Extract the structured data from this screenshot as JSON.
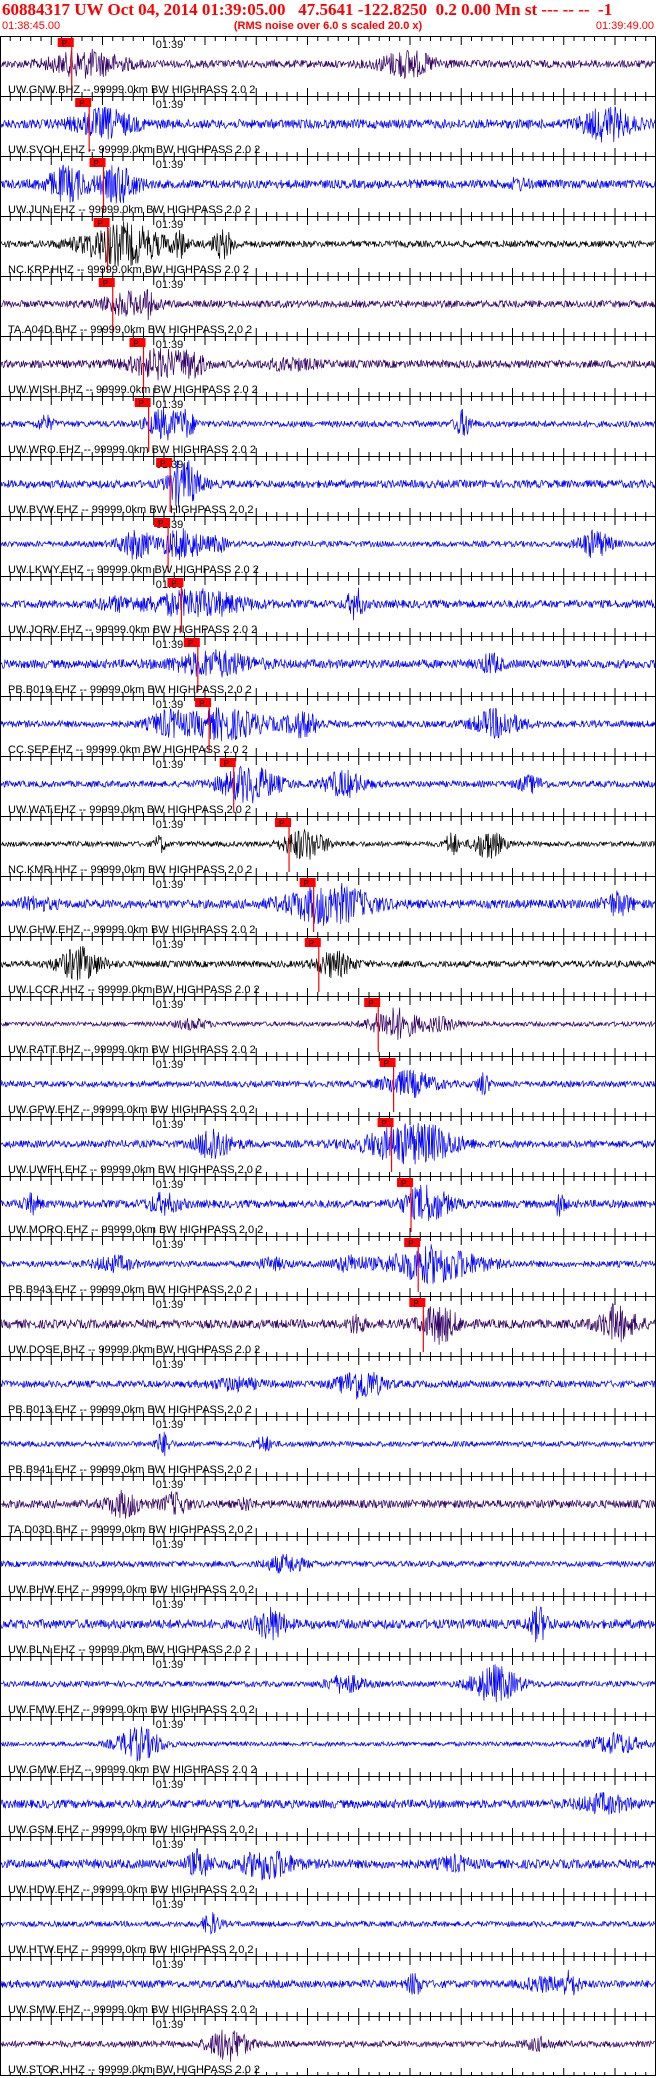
{
  "header": {
    "title": "60884317 UW Oct 04, 2014 01:39:05.00   47.5641 -122.8250  0.2 0.00 Mn st --- -- --  -1",
    "start_time": "01:38:45.00",
    "noise_note": "(RMS noise over 6.0 s scaled 20.0 x)",
    "end_time": "01:39:49.00"
  },
  "chart_data": {
    "type": "seismogram",
    "time_window": [
      "01:38:45.00",
      "01:39:49.00"
    ],
    "minute_tick_label": "01:39",
    "pick_label": "P",
    "colors": {
      "pick": "#ff0000",
      "blue": "#0000ff",
      "dark": "#330066",
      "black": "#000000",
      "axis": "#000000",
      "text": "#000000"
    },
    "traces": [
      {
        "label": "UW.GNW.BHZ -- 99999.0km BW  HIGHPASS  2.0  2",
        "color": "dark",
        "pick_s": 7.0
      },
      {
        "label": "UW.SVOH.EHZ -- 99999.0km BW  HIGHPASS  2.0  2",
        "color": "blue",
        "pick_s": 8.7
      },
      {
        "label": "UW.JUN.EHZ -- 99999.0km BW  HIGHPASS  2.0  2",
        "color": "blue",
        "pick_s": 10.1
      },
      {
        "label": "NC.KRP.HHZ -- 99999.0km BW  HIGHPASS  2.0  2",
        "color": "black",
        "pick_s": 10.5
      },
      {
        "label": "TA.A04D.BHZ -- 99999.0km BW  HIGHPASS  2.0  2",
        "color": "dark",
        "pick_s": 11.0
      },
      {
        "label": "UW.WISH.BHZ -- 99999.0km BW  HIGHPASS  2.0  2",
        "color": "dark",
        "pick_s": 14.0
      },
      {
        "label": "UW.WRO.EHZ -- 99999.0km BW  HIGHPASS  2.0  2",
        "color": "blue",
        "pick_s": 14.5
      },
      {
        "label": "UW.BVW.EHZ -- 99999.0km BW  HIGHPASS  2.0  2",
        "color": "blue",
        "pick_s": 16.6
      },
      {
        "label": "UW.LKWY.EHZ -- 99999.0km BW  HIGHPASS  2.0  2",
        "color": "blue",
        "pick_s": 16.4
      },
      {
        "label": "UW.JORV.EHZ -- 99999.0km BW  HIGHPASS  2.0  2",
        "color": "blue",
        "pick_s": 17.7
      },
      {
        "label": "PB.B019.EHZ -- 99999.0km BW  HIGHPASS  2.0  2",
        "color": "blue",
        "pick_s": 19.3
      },
      {
        "label": "CC.SEP.EHZ -- 99999.0km BW  HIGHPASS  2.0  2",
        "color": "blue",
        "pick_s": 20.4
      },
      {
        "label": "UW.WAT.EHZ -- 99999.0km BW  HIGHPASS  2.0  2",
        "color": "blue",
        "pick_s": 22.8
      },
      {
        "label": "NC.KMR.HHZ -- 99999.0km BW  HIGHPASS  2.0  2",
        "color": "black",
        "pick_s": 28.2
      },
      {
        "label": "UW.GHW.EHZ -- 99999.0km BW  HIGHPASS  2.0  2",
        "color": "blue",
        "pick_s": 30.6
      },
      {
        "label": "UW.LCCR.HHZ -- 99999.0km BW  HIGHPASS  2.0  2",
        "color": "black",
        "pick_s": 31.1
      },
      {
        "label": "UW.RATT.BHZ -- 99999.0km BW  HIGHPASS  2.0  2",
        "color": "dark",
        "pick_s": 36.9
      },
      {
        "label": "UW.GPW.EHZ -- 99999.0km BW  HIGHPASS  2.0  2",
        "color": "blue",
        "pick_s": 38.4
      },
      {
        "label": "UW.UWFH.EHZ -- 99999.0km BW  HIGHPASS  2.0  2",
        "color": "blue",
        "pick_s": 38.2
      },
      {
        "label": "UW.MORO.EHZ -- 99999.0km BW  HIGHPASS  2.0  2",
        "color": "blue",
        "pick_s": 40.1
      },
      {
        "label": "PB.B943.EHZ -- 99999.0km BW  HIGHPASS  2.0  2",
        "color": "blue",
        "pick_s": 40.8
      },
      {
        "label": "UW.DOSE.BHZ -- 99999.0km BW  HIGHPASS  2.0  2",
        "color": "dark",
        "pick_s": 41.3
      },
      {
        "label": "PB.B013.EHZ -- 99999.0km BW  HIGHPASS  2.0  2",
        "color": "blue",
        "pick_s": null
      },
      {
        "label": "PB.B941.EHZ -- 99999.0km BW  HIGHPASS  2.0  2",
        "color": "blue",
        "pick_s": null
      },
      {
        "label": "TA.D03D.BHZ -- 99999.0km BW  HIGHPASS  2.0  2",
        "color": "dark",
        "pick_s": null
      },
      {
        "label": "UW.BHW.EHZ -- 99999.0km BW  HIGHPASS  2.0  2",
        "color": "blue",
        "pick_s": null
      },
      {
        "label": "UW.BLN.EHZ -- 99999.0km BW  HIGHPASS  2.0  2",
        "color": "blue",
        "pick_s": null
      },
      {
        "label": "UW.FMW.EHZ -- 99999.0km BW  HIGHPASS  2.0  2",
        "color": "blue",
        "pick_s": null
      },
      {
        "label": "UW.GMW.EHZ -- 99999.0km BW  HIGHPASS  2.0  2",
        "color": "blue",
        "pick_s": null
      },
      {
        "label": "UW.GSM.EHZ -- 99999.0km BW  HIGHPASS  2.0  2",
        "color": "blue",
        "pick_s": null
      },
      {
        "label": "UW.HDW.EHZ -- 99999.0km BW  HIGHPASS  2.0  2",
        "color": "blue",
        "pick_s": null
      },
      {
        "label": "UW.HTW.EHZ -- 99999.0km BW  HIGHPASS  2.0  2",
        "color": "blue",
        "pick_s": null
      },
      {
        "label": "UW.SMW.EHZ -- 99999.0km BW  HIGHPASS  2.0  2",
        "color": "blue",
        "pick_s": null
      },
      {
        "label": "UW.STOR.HHZ -- 99999.0km BW  HIGHPASS  2.0  2",
        "color": "dark",
        "pick_s": null
      }
    ]
  }
}
